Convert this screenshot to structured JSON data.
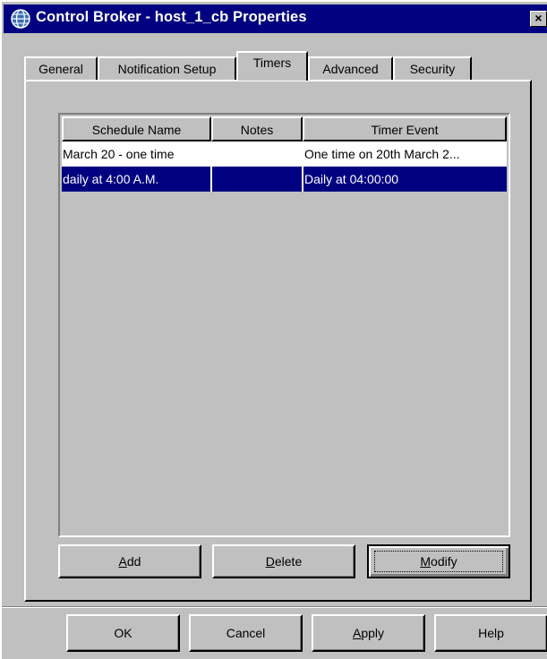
{
  "window": {
    "title": "Control Broker - host_1_cb Properties",
    "close_label": "×"
  },
  "tabs": [
    {
      "label": "General",
      "active": false
    },
    {
      "label": "Notification Setup",
      "active": false
    },
    {
      "label": "Timers",
      "active": true
    },
    {
      "label": "Advanced",
      "active": false
    },
    {
      "label": "Security",
      "active": false
    }
  ],
  "timers_list": {
    "columns": [
      "Schedule Name",
      "Notes",
      "Timer Event"
    ],
    "rows": [
      {
        "schedule_name": "March 20 - one time",
        "notes": "",
        "timer_event": "One time on 20th March 2...",
        "selected": false
      },
      {
        "schedule_name": "daily at 4:00 A.M.",
        "notes": "",
        "timer_event": "Daily at 04:00:00",
        "selected": true
      }
    ]
  },
  "list_buttons": {
    "add": {
      "mnemonic": "A",
      "rest": "dd"
    },
    "delete": {
      "mnemonic": "D",
      "rest": "elete"
    },
    "modify": {
      "mnemonic": "M",
      "rest": "odify"
    }
  },
  "dialog_buttons": {
    "ok": "OK",
    "cancel": "Cancel",
    "apply": {
      "mnemonic": "A",
      "rest": "pply"
    },
    "help": "Help"
  },
  "colors": {
    "titlebar": "#000080",
    "selection": "#000080",
    "face": "#c0c0c0"
  }
}
